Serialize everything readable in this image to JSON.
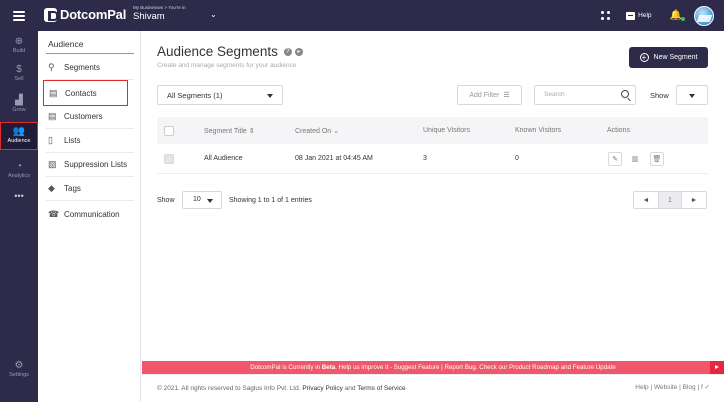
{
  "topbar": {
    "logo": "DotcomPal",
    "business_caption": "My Businesses > You're in",
    "business_name": "Shivam",
    "help_label": "Help"
  },
  "rail": [
    {
      "label": "Build",
      "icon": "plus-circle-icon"
    },
    {
      "label": "Sell",
      "icon": "dollar-icon"
    },
    {
      "label": "Grow",
      "icon": "bar-chart-icon"
    },
    {
      "label": "Audience",
      "icon": "people-icon",
      "active": true
    },
    {
      "label": "Analytics",
      "icon": "analytics-icon"
    },
    {
      "label": "•••",
      "icon": "more-icon"
    },
    {
      "label": "Settings",
      "icon": "gear-icon"
    }
  ],
  "subnav": {
    "title": "Audience",
    "items": [
      {
        "label": "Segments",
        "icon": "segments-icon"
      },
      {
        "label": "Contacts",
        "icon": "contacts-icon",
        "highlighted": true
      },
      {
        "label": "Customers",
        "icon": "customers-icon"
      },
      {
        "label": "Lists",
        "icon": "list-icon"
      },
      {
        "label": "Suppression Lists",
        "icon": "suppression-icon"
      },
      {
        "label": "Tags",
        "icon": "tag-icon"
      },
      {
        "label": "Communication",
        "icon": "communication-icon"
      }
    ]
  },
  "main": {
    "title": "Audience Segments",
    "subtitle": "Create and manage segments for your audience",
    "new_button": "New Segment",
    "filter_select": "All Segments (1)",
    "add_filter": "Add Filter",
    "search_placeholder": "Search",
    "show_label": "Show"
  },
  "table": {
    "columns": [
      "Segment Title",
      "Created On",
      "Unique Visitors",
      "Known Visitors",
      "Actions"
    ],
    "sort_marks": [
      "⇕",
      "⌄"
    ],
    "rows": [
      {
        "title": "All Audience",
        "created": "08 Jan 2021 at 04:45 AM",
        "unique": "3",
        "known": "0"
      }
    ]
  },
  "pagination": {
    "show_label": "Show",
    "page_size": "10",
    "info": "Showing 1 to 1 of 1 entries",
    "prev": "◄",
    "current": "1",
    "next": "►"
  },
  "banner": {
    "lead": "DotcomPal is Currently in ",
    "beta": "Beta",
    "rest": ". Help us improve it - Suggest Feature | Report Bug. Check our Product Roadmap and Feature Update"
  },
  "footer": {
    "copyright": "© 2021. All rights reserved to Saglus Info Pvt. Ltd.",
    "privacy": "Privacy Policy",
    "and": "and",
    "terms": "Terms of Service",
    "links": "Help  |  Website  |  Blog  |  f  ✓"
  },
  "colors": {
    "topbar": "#2e2b4a",
    "banner": "#f0576a",
    "highlight_border": "#e02b2b"
  }
}
